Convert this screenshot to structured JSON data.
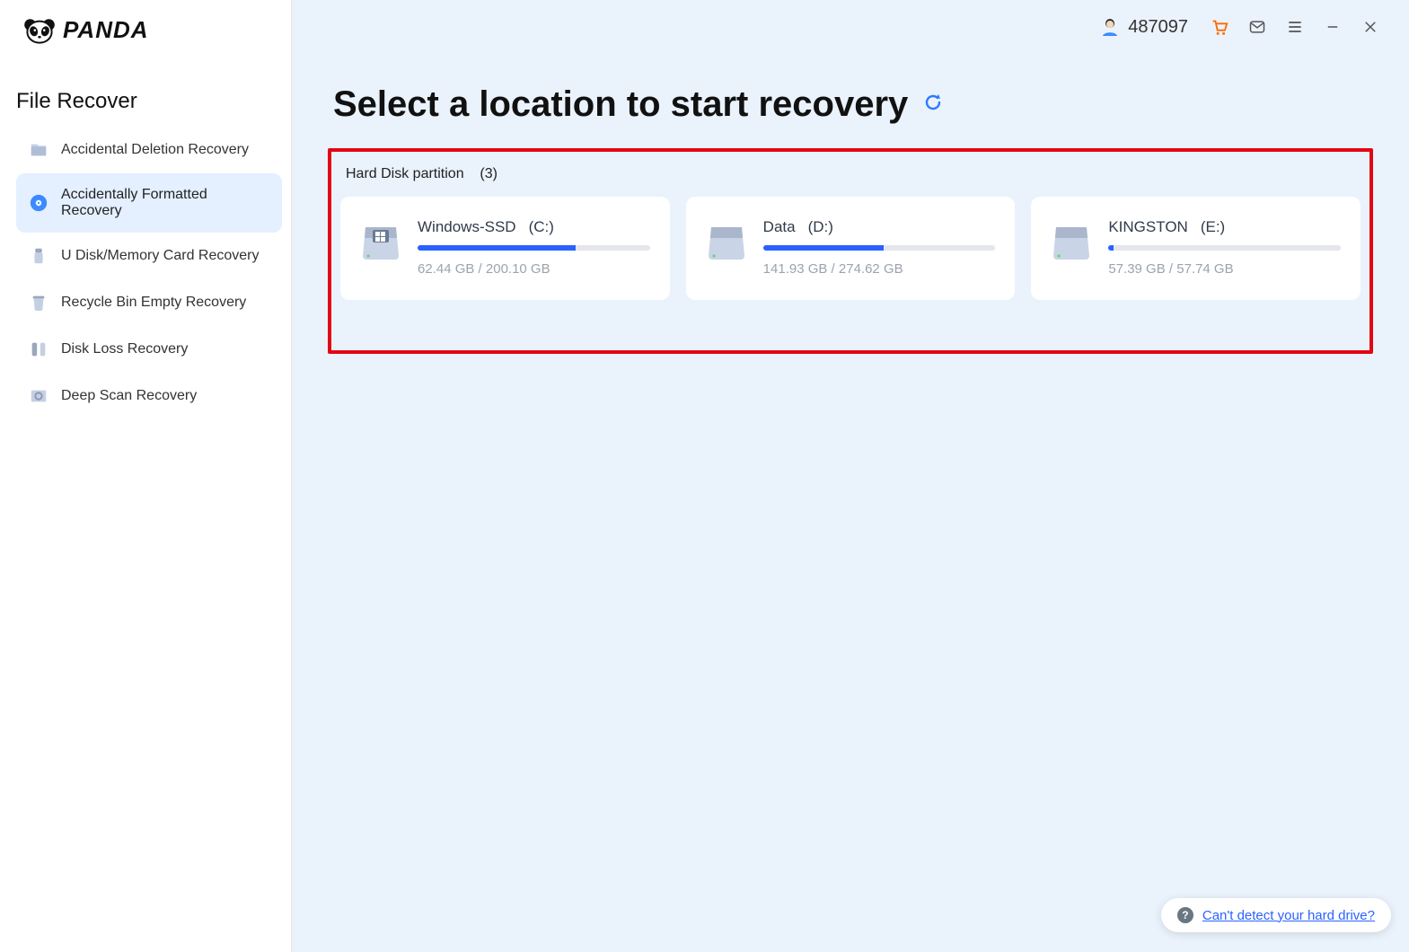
{
  "app": {
    "name": "PANDA"
  },
  "sidebar": {
    "title": "File Recover",
    "items": [
      {
        "label": "Accidental Deletion Recovery",
        "active": false
      },
      {
        "label": "Accidentally Formatted Recovery",
        "active": true
      },
      {
        "label": "U Disk/Memory Card Recovery",
        "active": false
      },
      {
        "label": "Recycle Bin Empty Recovery",
        "active": false
      },
      {
        "label": "Disk Loss Recovery",
        "active": false
      },
      {
        "label": "Deep Scan Recovery",
        "active": false
      }
    ]
  },
  "topbar": {
    "user_id": "487097"
  },
  "main": {
    "title": "Select a location to start recovery",
    "group_label": "Hard Disk partition",
    "group_count": "(3)",
    "partitions": [
      {
        "name": "Windows-SSD",
        "letter": "(C:)",
        "usage": "62.44 GB / 200.10 GB",
        "fill_pct": 68,
        "type": "windows"
      },
      {
        "name": "Data",
        "letter": "(D:)",
        "usage": "141.93 GB / 274.62 GB",
        "fill_pct": 52,
        "type": "drive"
      },
      {
        "name": "KINGSTON",
        "letter": "(E:)",
        "usage": "57.39 GB / 57.74 GB",
        "fill_pct": 2,
        "type": "drive"
      }
    ]
  },
  "help": {
    "text": "Can't detect your hard drive?"
  }
}
